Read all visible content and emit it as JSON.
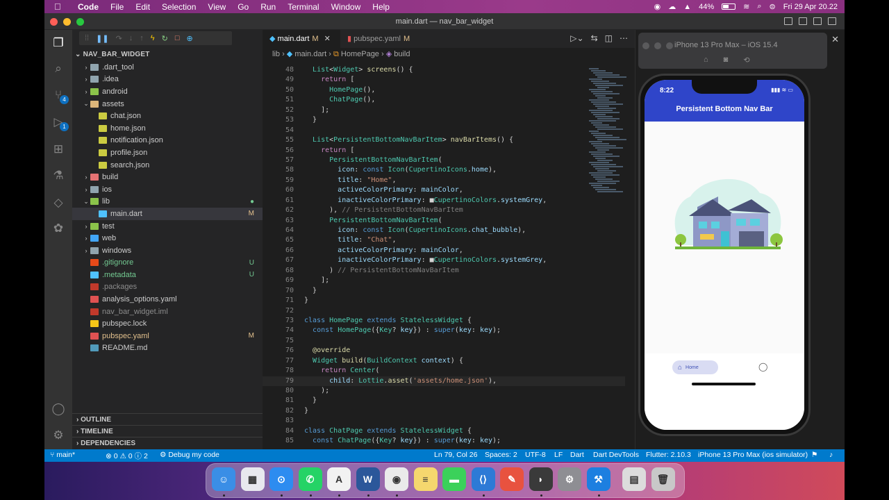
{
  "menubar": {
    "app": "Code",
    "items": [
      "File",
      "Edit",
      "Selection",
      "View",
      "Go",
      "Run",
      "Terminal",
      "Window",
      "Help"
    ],
    "battery": "44%",
    "datetime": "Fri 29 Apr  20.22"
  },
  "window": {
    "title": "main.dart — nav_bar_widget"
  },
  "explorer": {
    "root": "NAV_BAR_WIDGET",
    "items": [
      {
        "label": ".dart_tool",
        "kind": "folder",
        "level": 0,
        "open": false
      },
      {
        "label": ".idea",
        "kind": "folder",
        "level": 0,
        "open": false
      },
      {
        "label": "android",
        "kind": "folder-green",
        "level": 0,
        "open": false
      },
      {
        "label": "assets",
        "kind": "folder-open",
        "level": 0,
        "open": true
      },
      {
        "label": "chat.json",
        "kind": "json",
        "level": 1
      },
      {
        "label": "home.json",
        "kind": "json",
        "level": 1
      },
      {
        "label": "notification.json",
        "kind": "json",
        "level": 1
      },
      {
        "label": "profile.json",
        "kind": "json",
        "level": 1
      },
      {
        "label": "search.json",
        "kind": "json",
        "level": 1
      },
      {
        "label": "build",
        "kind": "folder-red",
        "level": 0,
        "open": false
      },
      {
        "label": "ios",
        "kind": "folder",
        "level": 0,
        "open": false
      },
      {
        "label": "lib",
        "kind": "folder-open-green",
        "level": 0,
        "open": true,
        "status": "●",
        "status_color": "#73c991"
      },
      {
        "label": "main.dart",
        "kind": "dart",
        "level": 1,
        "status": "M",
        "status_color": "#e2c08d",
        "selected": true
      },
      {
        "label": "test",
        "kind": "folder-green",
        "level": 0,
        "open": false
      },
      {
        "label": "web",
        "kind": "folder-blue",
        "level": 0,
        "open": false
      },
      {
        "label": "windows",
        "kind": "folder",
        "level": 0,
        "open": false
      },
      {
        "label": ".gitignore",
        "kind": "git",
        "level": 0,
        "status": "U",
        "status_color": "#73c991",
        "text_color": "#73c991"
      },
      {
        "label": ".metadata",
        "kind": "file-blue",
        "level": 0,
        "status": "U",
        "status_color": "#73c991",
        "text_color": "#73c991"
      },
      {
        "label": ".packages",
        "kind": "file-red",
        "level": 0,
        "text_color": "#8c8c8c"
      },
      {
        "label": "analysis_options.yaml",
        "kind": "yaml",
        "level": 0
      },
      {
        "label": "nav_bar_widget.iml",
        "kind": "iml",
        "level": 0,
        "text_color": "#8c8c8c"
      },
      {
        "label": "pubspec.lock",
        "kind": "lock",
        "level": 0
      },
      {
        "label": "pubspec.yaml",
        "kind": "yaml",
        "level": 0,
        "status": "M",
        "status_color": "#e2c08d",
        "text_color": "#e2c08d"
      },
      {
        "label": "README.md",
        "kind": "info",
        "level": 0
      }
    ],
    "sections": [
      "OUTLINE",
      "TIMELINE",
      "DEPENDENCIES"
    ]
  },
  "activity_badges": {
    "scm": "4",
    "debug": "1"
  },
  "tabs": [
    {
      "label": "main.dart",
      "mod": "M",
      "active": true
    },
    {
      "label": "pubspec.yaml",
      "mod": "M",
      "active": false
    }
  ],
  "breadcrumb": [
    "lib",
    "main.dart",
    "HomePage",
    "build"
  ],
  "code_lines": [
    {
      "n": "48",
      "html": "  <span class='ty'>List</span>&lt;<span class='ty'>Widget</span>&gt; <span class='fn'>screens</span>() {"
    },
    {
      "n": "49",
      "html": "    <span class='pu'>return</span> ["
    },
    {
      "n": "50",
      "html": "      <span class='ty'>HomePage</span>(),"
    },
    {
      "n": "51",
      "html": "      <span class='ty'>ChatPage</span>(),"
    },
    {
      "n": "52",
      "html": "    ];"
    },
    {
      "n": "53",
      "html": "  }"
    },
    {
      "n": "54",
      "html": ""
    },
    {
      "n": "55",
      "html": "  <span class='ty'>List</span>&lt;<span class='ty'>PersistentBottomNavBarItem</span>&gt; <span class='fn'>navBarItems</span>() {"
    },
    {
      "n": "56",
      "html": "    <span class='pu'>return</span> ["
    },
    {
      "n": "57",
      "html": "      <span class='ty'>PersistentBottomNavBarItem</span>("
    },
    {
      "n": "58",
      "html": "        <span class='pa'>icon</span>: <span class='kw'>const</span> <span class='ty'>Icon</span>(<span class='ty'>CupertinoIcons</span>.<span class='pa'>home</span>),"
    },
    {
      "n": "59",
      "html": "        <span class='pa'>title</span>: <span class='st'>\"Home\"</span>,"
    },
    {
      "n": "60",
      "html": "        <span class='pa'>activeColorPrimary</span>: <span class='pa'>mainColor</span>,"
    },
    {
      "n": "61",
      "html": "        <span class='pa'>inactiveColorPrimary</span>: ■<span class='ty'>CupertinoColors</span>.<span class='pa'>systemGrey</span>,"
    },
    {
      "n": "62",
      "html": "      ), <span class='gy'>// PersistentBottomNavBarItem</span>"
    },
    {
      "n": "63",
      "html": "      <span class='ty'>PersistentBottomNavBarItem</span>("
    },
    {
      "n": "64",
      "html": "        <span class='pa'>icon</span>: <span class='kw'>const</span> <span class='ty'>Icon</span>(<span class='ty'>CupertinoIcons</span>.<span class='pa'>chat_bubble</span>),"
    },
    {
      "n": "65",
      "html": "        <span class='pa'>title</span>: <span class='st'>\"Chat\"</span>,"
    },
    {
      "n": "66",
      "html": "        <span class='pa'>activeColorPrimary</span>: <span class='pa'>mainColor</span>,"
    },
    {
      "n": "67",
      "html": "        <span class='pa'>inactiveColorPrimary</span>: ■<span class='ty'>CupertinoColors</span>.<span class='pa'>systemGrey</span>,"
    },
    {
      "n": "68",
      "html": "      ) <span class='gy'>// PersistentBottomNavBarItem</span>"
    },
    {
      "n": "69",
      "html": "    ];"
    },
    {
      "n": "70",
      "html": "  }"
    },
    {
      "n": "71",
      "html": "}"
    },
    {
      "n": "72",
      "html": ""
    },
    {
      "n": "73",
      "html": "<span class='kw'>class</span> <span class='ty'>HomePage</span> <span class='kw'>extends</span> <span class='ty'>StatelessWidget</span> {"
    },
    {
      "n": "74",
      "html": "  <span class='kw'>const</span> <span class='ty'>HomePage</span>({<span class='ty'>Key</span>? <span class='pa'>key</span>}) : <span class='kw'>super</span>(<span class='pa'>key</span>: <span class='pa'>key</span>);"
    },
    {
      "n": "75",
      "html": ""
    },
    {
      "n": "76",
      "html": "  <span class='fn'>@override</span>"
    },
    {
      "n": "77",
      "html": "  <span class='ty'>Widget</span> <span class='fn'>build</span>(<span class='ty'>BuildContext</span> <span class='pa'>context</span>) {"
    },
    {
      "n": "78",
      "html": "    <span class='pu'>return</span> <span class='ty'>Center</span>("
    },
    {
      "n": "79",
      "html": "      <span class='pa'>child</span>: <span class='ty'>Lottie</span>.<span class='fn'>asset</span>(<span class='st'>'assets/home.json'</span>),",
      "current": true
    },
    {
      "n": "80",
      "html": "    );"
    },
    {
      "n": "81",
      "html": "  }"
    },
    {
      "n": "82",
      "html": "}"
    },
    {
      "n": "83",
      "html": ""
    },
    {
      "n": "84",
      "html": "<span class='kw'>class</span> <span class='ty'>ChatPage</span> <span class='kw'>extends</span> <span class='ty'>StatelessWidget</span> {"
    },
    {
      "n": "85",
      "html": "  <span class='kw'>const</span> <span class='ty'>ChatPage</span>({<span class='ty'>Key</span>? <span class='pa'>key</span>}) : <span class='kw'>super</span>(<span class='pa'>key</span>: <span class='pa'>key</span>);"
    }
  ],
  "simulator": {
    "title": "iPhone 13 Pro Max – iOS 15.4",
    "time": "8:22",
    "app_title": "Persistent Bottom Nav Bar",
    "nav_home": "Home"
  },
  "statusbar": {
    "branch": "main*",
    "problems": "⊗ 0 ⚠ 0 ⓘ 2",
    "debug": "Debug my code",
    "position": "Ln 79, Col 26",
    "spaces": "Spaces: 2",
    "encoding": "UTF-8",
    "eol": "LF",
    "language": "Dart",
    "devtools": "Dart DevTools",
    "flutter": "Flutter: 2.10.3",
    "device": "iPhone 13 Pro Max (ios simulator)"
  },
  "dock": [
    {
      "name": "finder",
      "color": "#3a8ee6",
      "glyph": "☺"
    },
    {
      "name": "launchpad",
      "color": "#e8e8ee",
      "glyph": "▦"
    },
    {
      "name": "safari",
      "color": "#2d8cf0",
      "glyph": "⊙"
    },
    {
      "name": "whatsapp",
      "color": "#25d366",
      "glyph": "✆"
    },
    {
      "name": "app-a",
      "color": "#f2f2f2",
      "glyph": "A"
    },
    {
      "name": "word",
      "color": "#2b579a",
      "glyph": "W"
    },
    {
      "name": "chrome",
      "color": "#eaeaea",
      "glyph": "◉"
    },
    {
      "name": "notes",
      "color": "#f5d76e",
      "glyph": "≡"
    },
    {
      "name": "messages",
      "color": "#3bd15a",
      "glyph": "▬"
    },
    {
      "name": "vscode",
      "color": "#2d7ad6",
      "glyph": "⟨⟩"
    },
    {
      "name": "pen",
      "color": "#e8523f",
      "glyph": "✎"
    },
    {
      "name": "elephant",
      "color": "#3a3a3a",
      "glyph": "◗"
    },
    {
      "name": "settings",
      "color": "#8e8e93",
      "glyph": "⚙"
    },
    {
      "name": "xcode",
      "color": "#1d7fe0",
      "glyph": "⚒"
    },
    {
      "name": "file",
      "color": "#dcdcdc",
      "glyph": "▤"
    },
    {
      "name": "trash",
      "color": "#c8c8c8",
      "glyph": "🗑"
    }
  ]
}
